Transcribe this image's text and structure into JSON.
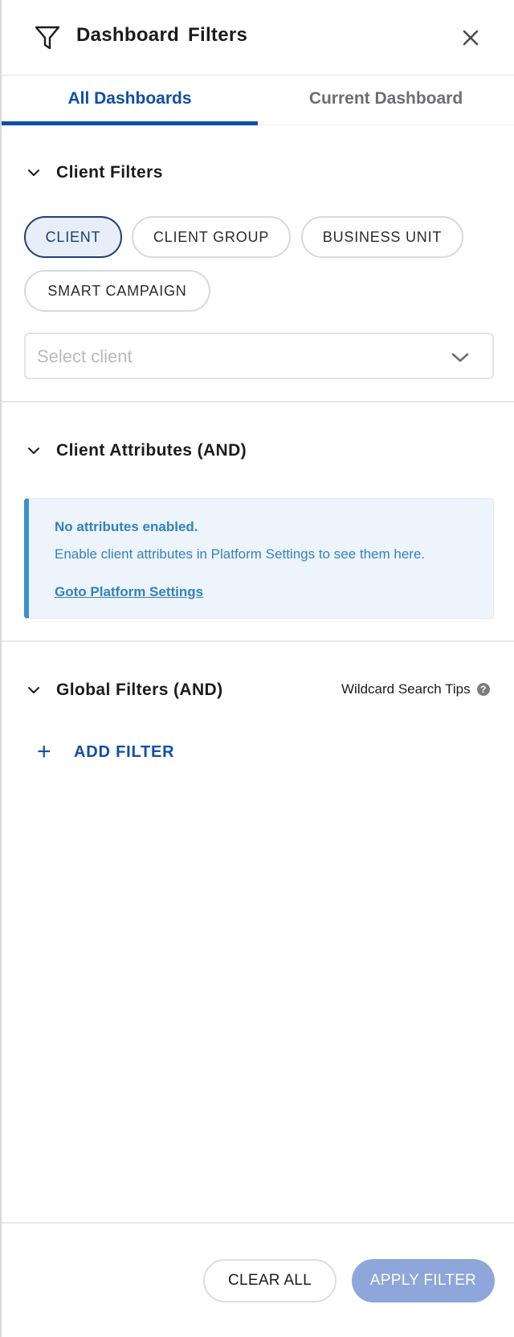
{
  "header": {
    "title": "Dashboard  Filters",
    "icon": "filter-icon",
    "close_icon": "close-icon"
  },
  "tabs": [
    {
      "label": "All Dashboards",
      "active": true
    },
    {
      "label": "Current Dashboard",
      "active": false
    }
  ],
  "client_filters": {
    "label": "Client Filters",
    "chips": [
      {
        "label": "CLIENT",
        "selected": true
      },
      {
        "label": "CLIENT GROUP",
        "selected": false
      },
      {
        "label": "BUSINESS UNIT",
        "selected": false
      },
      {
        "label": "SMART CAMPAIGN",
        "selected": false
      }
    ],
    "select": {
      "placeholder": "Select client",
      "value": ""
    }
  },
  "client_attributes": {
    "label": "Client Attributes (AND)",
    "info": {
      "title": "No attributes enabled.",
      "text": "Enable client attributes in Platform Settings to see them here.",
      "link": "Goto Platform Settings"
    }
  },
  "global_filters": {
    "label": "Global Filters (AND)",
    "tips_label": "Wildcard Search Tips",
    "help_glyph": "?",
    "add_label": "ADD FILTER",
    "add_glyph": "+"
  },
  "footer": {
    "clear_label": "CLEAR ALL",
    "apply_label": "APPLY FILTER"
  },
  "colors": {
    "accent": "#0f4fa8",
    "info_text": "#3281c0",
    "info_bg": "#eef4fb",
    "apply_bg": "#8ea6da",
    "selected_chip_bg": "#e8eef8"
  }
}
